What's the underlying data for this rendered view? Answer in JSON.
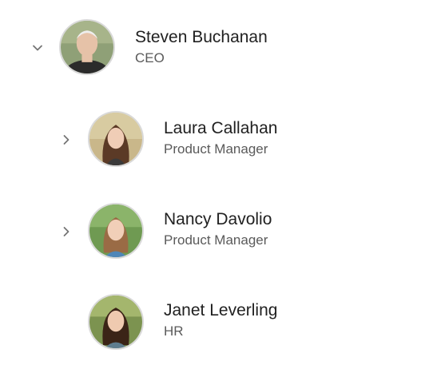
{
  "tree": {
    "nodes": [
      {
        "name": "Steven Buchanan",
        "role": "CEO",
        "expanded": true,
        "has_children": true,
        "avatar_icon": "person-photo-elderly-man"
      },
      {
        "name": "Laura Callahan",
        "role": "Product Manager",
        "expanded": false,
        "has_children": true,
        "avatar_icon": "person-photo-woman"
      },
      {
        "name": "Nancy Davolio",
        "role": "Product Manager",
        "expanded": false,
        "has_children": true,
        "avatar_icon": "person-photo-woman"
      },
      {
        "name": "Janet Leverling",
        "role": "HR",
        "expanded": false,
        "has_children": false,
        "avatar_icon": "person-photo-woman"
      }
    ],
    "colors": {
      "chevron": "#757575",
      "name": "#212121",
      "role": "#5a5a5a"
    }
  }
}
